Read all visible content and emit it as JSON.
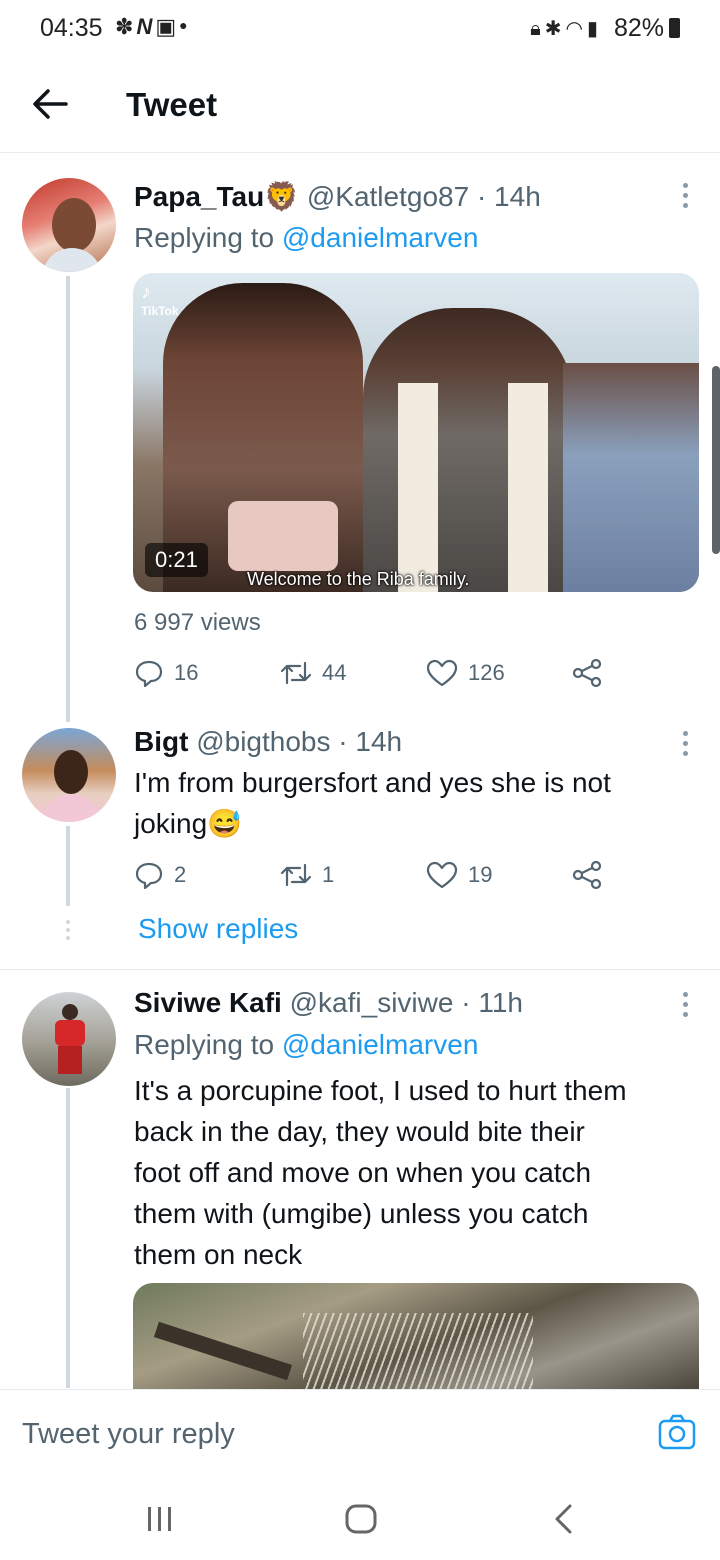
{
  "status_bar": {
    "time": "04:35",
    "left_icons": [
      "fan-icon",
      "n-icon",
      "gallery-icon",
      "dot-icon"
    ],
    "right_icons": [
      "lock-icon",
      "bluetooth-icon",
      "wifi-icon",
      "signal-icon"
    ],
    "battery": "82%"
  },
  "header": {
    "title": "Tweet"
  },
  "tweets": [
    {
      "display_name": "Papa_Tau",
      "name_emoji": "🦁",
      "handle": "@Katletgo87",
      "time": "· 14h",
      "replying_label": "Replying to",
      "replying_to": "@danielmarven",
      "video": {
        "duration": "0:21",
        "caption": "Welcome to the Riba family.",
        "watermark": "TikTok"
      },
      "views": "6 997 views",
      "stats": {
        "replies": "16",
        "retweets": "44",
        "likes": "126"
      }
    },
    {
      "display_name": "Bigt",
      "handle": "@bigthobs",
      "time": "· 14h",
      "text_line1": "I'm from burgersfort and yes she is not",
      "text_line2": "joking",
      "text_emoji": "😅",
      "stats": {
        "replies": "2",
        "retweets": "1",
        "likes": "19"
      },
      "show_replies": "Show replies"
    },
    {
      "display_name": "Siviwe Kafi",
      "handle": "@kafi_siviwe",
      "time": "· 11h",
      "replying_label": "Replying to",
      "replying_to": "@danielmarven",
      "text_lines": [
        "It's a porcupine foot, I used to hurt them",
        "back in the day, they would bite their",
        "foot off and move on when you catch",
        "them with (umgibe) unless you catch",
        "them on neck"
      ]
    }
  ],
  "reply_box": {
    "placeholder": "Tweet your reply"
  },
  "colors": {
    "accent": "#1d9bf0",
    "muted": "#536471",
    "text": "#0f1419",
    "divider": "#e6ecf0"
  }
}
